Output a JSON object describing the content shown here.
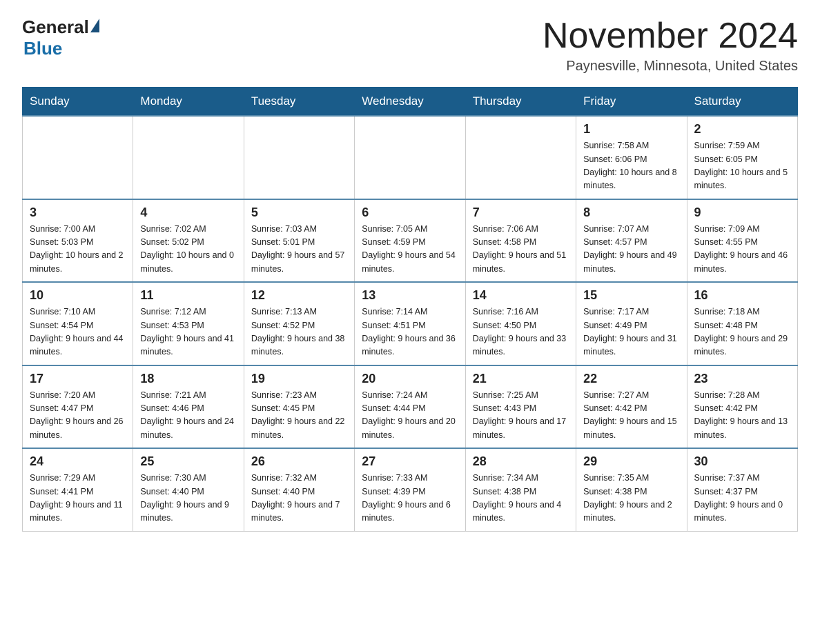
{
  "header": {
    "logo_general": "General",
    "logo_blue": "Blue",
    "month_title": "November 2024",
    "location": "Paynesville, Minnesota, United States"
  },
  "calendar": {
    "weekdays": [
      "Sunday",
      "Monday",
      "Tuesday",
      "Wednesday",
      "Thursday",
      "Friday",
      "Saturday"
    ],
    "weeks": [
      [
        {
          "day": "",
          "info": ""
        },
        {
          "day": "",
          "info": ""
        },
        {
          "day": "",
          "info": ""
        },
        {
          "day": "",
          "info": ""
        },
        {
          "day": "",
          "info": ""
        },
        {
          "day": "1",
          "info": "Sunrise: 7:58 AM\nSunset: 6:06 PM\nDaylight: 10 hours and 8 minutes."
        },
        {
          "day": "2",
          "info": "Sunrise: 7:59 AM\nSunset: 6:05 PM\nDaylight: 10 hours and 5 minutes."
        }
      ],
      [
        {
          "day": "3",
          "info": "Sunrise: 7:00 AM\nSunset: 5:03 PM\nDaylight: 10 hours and 2 minutes."
        },
        {
          "day": "4",
          "info": "Sunrise: 7:02 AM\nSunset: 5:02 PM\nDaylight: 10 hours and 0 minutes."
        },
        {
          "day": "5",
          "info": "Sunrise: 7:03 AM\nSunset: 5:01 PM\nDaylight: 9 hours and 57 minutes."
        },
        {
          "day": "6",
          "info": "Sunrise: 7:05 AM\nSunset: 4:59 PM\nDaylight: 9 hours and 54 minutes."
        },
        {
          "day": "7",
          "info": "Sunrise: 7:06 AM\nSunset: 4:58 PM\nDaylight: 9 hours and 51 minutes."
        },
        {
          "day": "8",
          "info": "Sunrise: 7:07 AM\nSunset: 4:57 PM\nDaylight: 9 hours and 49 minutes."
        },
        {
          "day": "9",
          "info": "Sunrise: 7:09 AM\nSunset: 4:55 PM\nDaylight: 9 hours and 46 minutes."
        }
      ],
      [
        {
          "day": "10",
          "info": "Sunrise: 7:10 AM\nSunset: 4:54 PM\nDaylight: 9 hours and 44 minutes."
        },
        {
          "day": "11",
          "info": "Sunrise: 7:12 AM\nSunset: 4:53 PM\nDaylight: 9 hours and 41 minutes."
        },
        {
          "day": "12",
          "info": "Sunrise: 7:13 AM\nSunset: 4:52 PM\nDaylight: 9 hours and 38 minutes."
        },
        {
          "day": "13",
          "info": "Sunrise: 7:14 AM\nSunset: 4:51 PM\nDaylight: 9 hours and 36 minutes."
        },
        {
          "day": "14",
          "info": "Sunrise: 7:16 AM\nSunset: 4:50 PM\nDaylight: 9 hours and 33 minutes."
        },
        {
          "day": "15",
          "info": "Sunrise: 7:17 AM\nSunset: 4:49 PM\nDaylight: 9 hours and 31 minutes."
        },
        {
          "day": "16",
          "info": "Sunrise: 7:18 AM\nSunset: 4:48 PM\nDaylight: 9 hours and 29 minutes."
        }
      ],
      [
        {
          "day": "17",
          "info": "Sunrise: 7:20 AM\nSunset: 4:47 PM\nDaylight: 9 hours and 26 minutes."
        },
        {
          "day": "18",
          "info": "Sunrise: 7:21 AM\nSunset: 4:46 PM\nDaylight: 9 hours and 24 minutes."
        },
        {
          "day": "19",
          "info": "Sunrise: 7:23 AM\nSunset: 4:45 PM\nDaylight: 9 hours and 22 minutes."
        },
        {
          "day": "20",
          "info": "Sunrise: 7:24 AM\nSunset: 4:44 PM\nDaylight: 9 hours and 20 minutes."
        },
        {
          "day": "21",
          "info": "Sunrise: 7:25 AM\nSunset: 4:43 PM\nDaylight: 9 hours and 17 minutes."
        },
        {
          "day": "22",
          "info": "Sunrise: 7:27 AM\nSunset: 4:42 PM\nDaylight: 9 hours and 15 minutes."
        },
        {
          "day": "23",
          "info": "Sunrise: 7:28 AM\nSunset: 4:42 PM\nDaylight: 9 hours and 13 minutes."
        }
      ],
      [
        {
          "day": "24",
          "info": "Sunrise: 7:29 AM\nSunset: 4:41 PM\nDaylight: 9 hours and 11 minutes."
        },
        {
          "day": "25",
          "info": "Sunrise: 7:30 AM\nSunset: 4:40 PM\nDaylight: 9 hours and 9 minutes."
        },
        {
          "day": "26",
          "info": "Sunrise: 7:32 AM\nSunset: 4:40 PM\nDaylight: 9 hours and 7 minutes."
        },
        {
          "day": "27",
          "info": "Sunrise: 7:33 AM\nSunset: 4:39 PM\nDaylight: 9 hours and 6 minutes."
        },
        {
          "day": "28",
          "info": "Sunrise: 7:34 AM\nSunset: 4:38 PM\nDaylight: 9 hours and 4 minutes."
        },
        {
          "day": "29",
          "info": "Sunrise: 7:35 AM\nSunset: 4:38 PM\nDaylight: 9 hours and 2 minutes."
        },
        {
          "day": "30",
          "info": "Sunrise: 7:37 AM\nSunset: 4:37 PM\nDaylight: 9 hours and 0 minutes."
        }
      ]
    ]
  }
}
